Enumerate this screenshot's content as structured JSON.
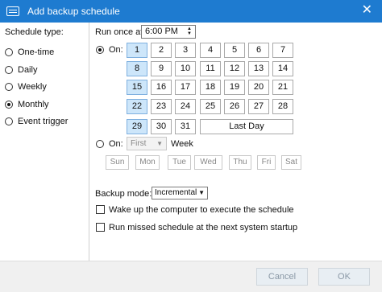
{
  "window": {
    "title": "Add backup schedule",
    "close_icon": "close-icon"
  },
  "schedule_type": {
    "label": "Schedule type:",
    "options": [
      "One-time",
      "Daily",
      "Weekly",
      "Monthly",
      "Event trigger"
    ],
    "selected": "Monthly"
  },
  "run_once_at": {
    "label": "Run once at",
    "time": "6:00 PM"
  },
  "on_days": {
    "label": "On:",
    "days": [
      "1",
      "2",
      "3",
      "4",
      "5",
      "6",
      "7",
      "8",
      "9",
      "10",
      "11",
      "12",
      "13",
      "14",
      "15",
      "16",
      "17",
      "18",
      "19",
      "20",
      "21",
      "22",
      "23",
      "24",
      "25",
      "26",
      "27",
      "28",
      "29",
      "30",
      "31"
    ],
    "selected_days": [
      "1",
      "8",
      "15",
      "22",
      "29"
    ],
    "last_day_label": "Last Day"
  },
  "on_week": {
    "label": "On:",
    "ordinal": "First",
    "week_label": "Week",
    "weekdays": [
      "Sun",
      "Mon",
      "Tue",
      "Wed",
      "Thu",
      "Fri",
      "Sat"
    ]
  },
  "backup_mode": {
    "label": "Backup mode:",
    "value": "Incremental"
  },
  "options": {
    "wake_label": "Wake up the computer to execute the schedule",
    "missed_label": "Run missed schedule at the next system startup"
  },
  "footer": {
    "cancel": "Cancel",
    "ok": "OK"
  },
  "colors": {
    "titlebar": "#1e7bd0",
    "selected_day": "#cde6fa"
  }
}
